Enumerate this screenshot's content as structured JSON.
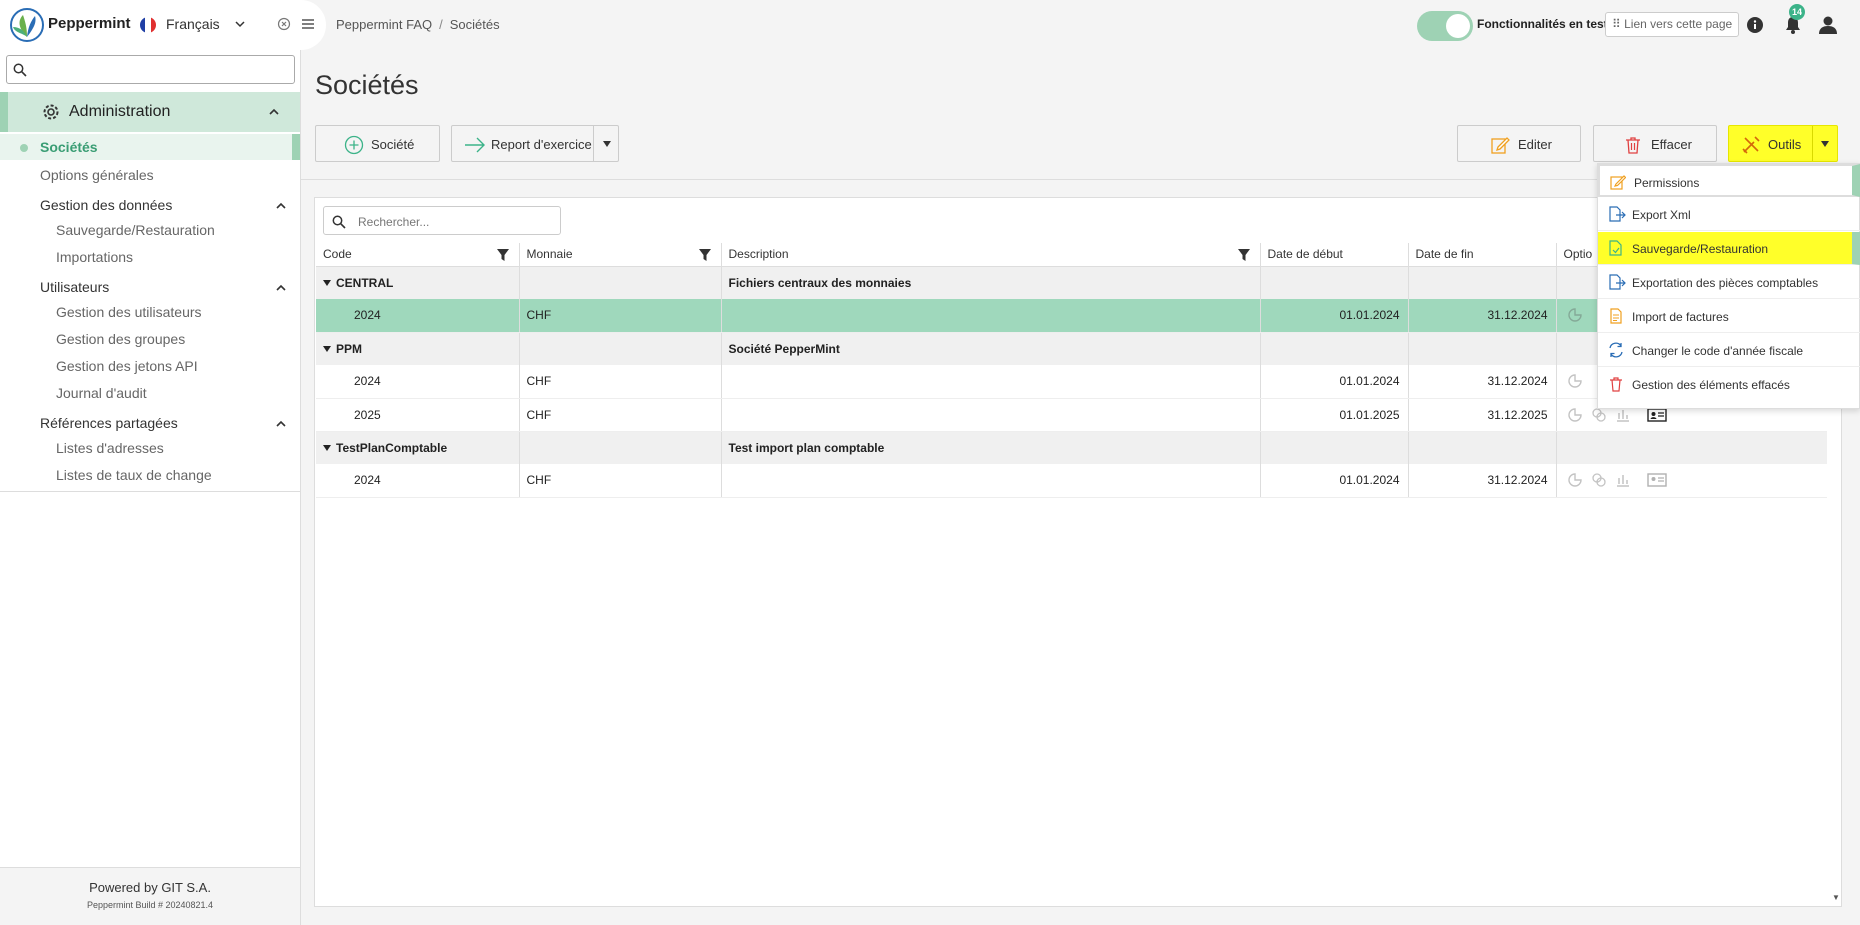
{
  "topbar": {
    "app_name": "Peppermint",
    "language": "Français",
    "breadcrumb": [
      "Peppermint FAQ",
      "Sociétés"
    ],
    "toggle_label": "Fonctionnalités en test",
    "link_label": "Lien vers cette page",
    "notifications_count": "14",
    "toggle_on": true
  },
  "sidebar": {
    "search_placeholder": "",
    "admin_label": "Administration",
    "active_item": "Sociétés",
    "options_generales": "Options générales",
    "sections": [
      {
        "label": "Gestion des données",
        "items": [
          "Sauvegarde/Restauration",
          "Importations"
        ]
      },
      {
        "label": "Utilisateurs",
        "items": [
          "Gestion des utilisateurs",
          "Gestion des groupes",
          "Gestion des jetons API",
          "Journal d'audit"
        ]
      },
      {
        "label": "Références partagées",
        "items": [
          "Listes d'adresses",
          "Listes de taux de change"
        ]
      }
    ],
    "footer_powered": "Powered by GIT S.A.",
    "footer_build": "Peppermint Build # 20240821.4"
  },
  "main": {
    "title": "Sociétés",
    "buttons": {
      "societe": "Société",
      "report": "Report d'exercice",
      "editer": "Editer",
      "effacer": "Effacer",
      "outils": "Outils"
    },
    "grid_search_placeholder": "Rechercher...",
    "columns": [
      "Code",
      "Monnaie",
      "Description",
      "Date de début",
      "Date de fin",
      "Optio"
    ],
    "groups": [
      {
        "code": "CENTRAL",
        "description": "Fichiers centraux des monnaies",
        "rows": [
          {
            "code": "2024",
            "currency": "CHF",
            "start": "01.01.2024",
            "end": "31.12.2024",
            "selected": true
          }
        ]
      },
      {
        "code": "PPM",
        "description": "Société PepperMint",
        "rows": [
          {
            "code": "2024",
            "currency": "CHF",
            "start": "01.01.2024",
            "end": "31.12.2024"
          },
          {
            "code": "2025",
            "currency": "CHF",
            "start": "01.01.2025",
            "end": "31.12.2025"
          }
        ]
      },
      {
        "code": "TestPlanComptable",
        "description": "Test import plan comptable",
        "rows": [
          {
            "code": "2024",
            "currency": "CHF",
            "start": "01.01.2024",
            "end": "31.12.2024"
          }
        ]
      }
    ]
  },
  "tools_menu": [
    {
      "label": "Permissions",
      "icon": "edit-icon"
    },
    {
      "label": "Export Xml",
      "icon": "export-file-icon"
    },
    {
      "label": "Sauvegarde/Restauration",
      "icon": "backup-file-icon",
      "highlighted": true
    },
    {
      "label": "Exportation des pièces comptables",
      "icon": "export-file-icon"
    },
    {
      "label": "Import de factures",
      "icon": "invoice-icon"
    },
    {
      "label": "Changer le code d'année fiscale",
      "icon": "refresh-icon"
    },
    {
      "label": "Gestion des éléments effacés",
      "icon": "trash-icon"
    }
  ],
  "colors": {
    "accent": "#9ed2b4",
    "highlight": "#ffff29",
    "selected_row": "#9fd8bc"
  }
}
